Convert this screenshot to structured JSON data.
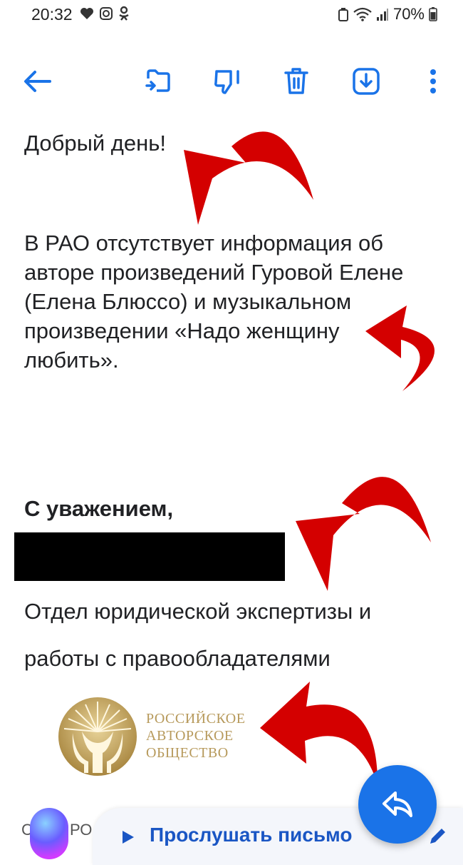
{
  "status_bar": {
    "time": "20:32",
    "battery": "70%",
    "icons_left": [
      "heart-icon",
      "instagram-icon",
      "ok-icon"
    ],
    "icons_right": [
      "recycle-icon",
      "wifi-icon",
      "signal-icon",
      "battery-icon"
    ]
  },
  "toolbar": {
    "back": "back-arrow-icon",
    "actions": [
      "move-icon",
      "dislike-icon",
      "delete-icon",
      "save-icon",
      "more-icon"
    ],
    "accent": "#1a73e8"
  },
  "email": {
    "greeting": "Добрый день!",
    "body_lines": [
      "В РАО отсутствует информация об",
      "авторе произведений Гуровой Елене",
      "(Елена Блюссо) и музыкальном",
      "произведении «Надо женщину",
      "любить»."
    ],
    "signoff": "С уважением,",
    "department_line1": "Отдел юридической экспертизы и",
    "department_line2": "работы с правообладателями",
    "logo_lines": [
      "РОССИЙСКОЕ",
      "АВТОРСКОЕ",
      "ОБЩЕСТВО"
    ],
    "footer_partial_left": "С",
    "footer_partial_right": "РО"
  },
  "listen_bar": {
    "label": "Прослушать письмо"
  },
  "annotation_color": "#d40000"
}
